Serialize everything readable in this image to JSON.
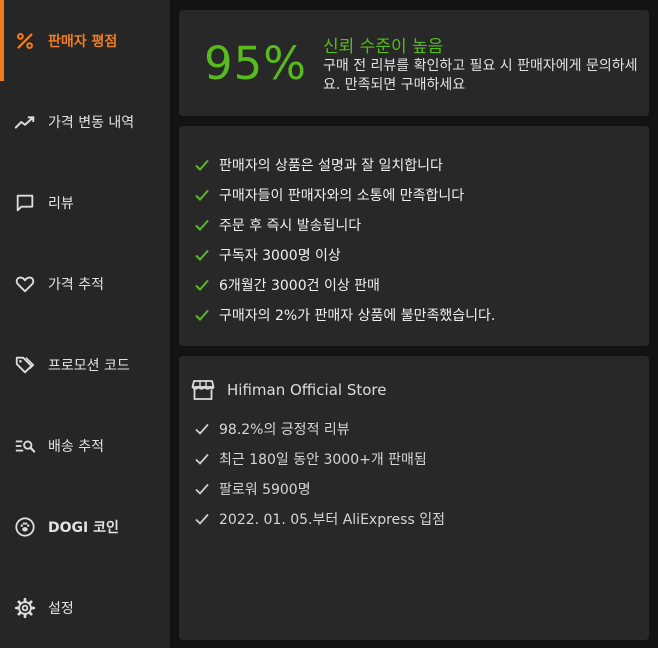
{
  "sidebar": {
    "items": [
      {
        "label": "판매자 평점",
        "icon": "percent-icon"
      },
      {
        "label": "가격 변동 내역",
        "icon": "trend-line-icon"
      },
      {
        "label": "리뷰",
        "icon": "chat-bubble-icon"
      },
      {
        "label": "가격 추적",
        "icon": "heart-icon"
      },
      {
        "label": "프로모션 코드",
        "icon": "tags-icon"
      },
      {
        "label": "배송 추적",
        "icon": "list-search-icon"
      },
      {
        "label": "DOGI 코인",
        "icon": "paw-coin-icon"
      },
      {
        "label": "설정",
        "icon": "gear-icon"
      }
    ],
    "active_index": 0
  },
  "score": {
    "value": "95%",
    "title": "신뢰 수준이 높음",
    "description": "구매 전 리뷰를 확인하고 필요 시 판매자에게 문의하세요. 만족되면 구매하세요"
  },
  "checks": [
    "판매자의 상품은 설명과 잘 일치합니다",
    "구매자들이 판매자와의 소통에 만족합니다",
    "주문 후 즉시 발송됩니다",
    "구독자 3000명 이상",
    "6개월간 3000건 이상 판매",
    "구매자의 2%가 판매자 상품에 불만족했습니다."
  ],
  "store": {
    "name": "Hifiman Official Store",
    "icon": "storefront-icon",
    "facts": [
      "98.2%의 긍정적 리뷰",
      "최근 180일 동안 3000+개 판매됨",
      "팔로워 5900명",
      "2022. 01. 05.부터 AliExpress 입점"
    ]
  },
  "colors": {
    "accent": "#f07c1f",
    "trust_green": "#57bb1d",
    "panel": "#282828",
    "sidebar": "#262626",
    "background": "#131313"
  }
}
